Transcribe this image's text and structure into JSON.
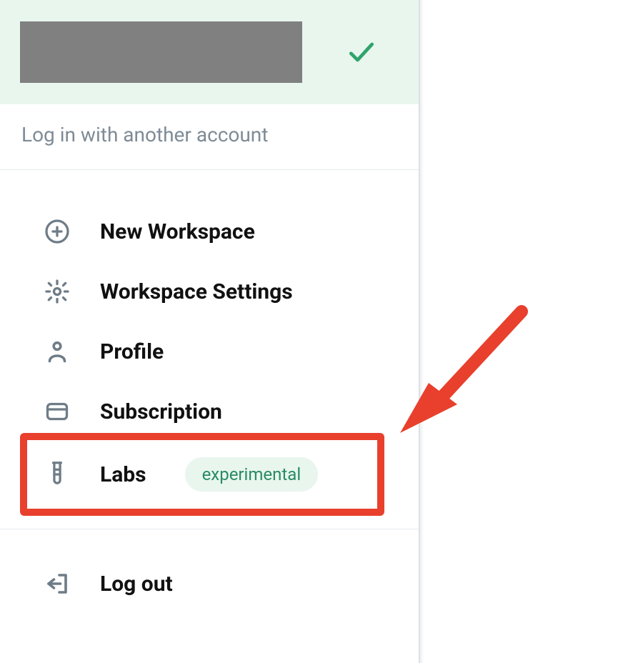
{
  "account": {
    "login_another": "Log in with another account"
  },
  "menu": {
    "new_workspace": "New Workspace",
    "workspace_settings": "Workspace Settings",
    "profile": "Profile",
    "subscription": "Subscription",
    "labs": "Labs",
    "labs_badge": "experimental",
    "logout": "Log out"
  },
  "colors": {
    "accent_green": "#2fa36b",
    "highlight_red": "#e8402d",
    "icon_gray": "#6e7c87"
  }
}
